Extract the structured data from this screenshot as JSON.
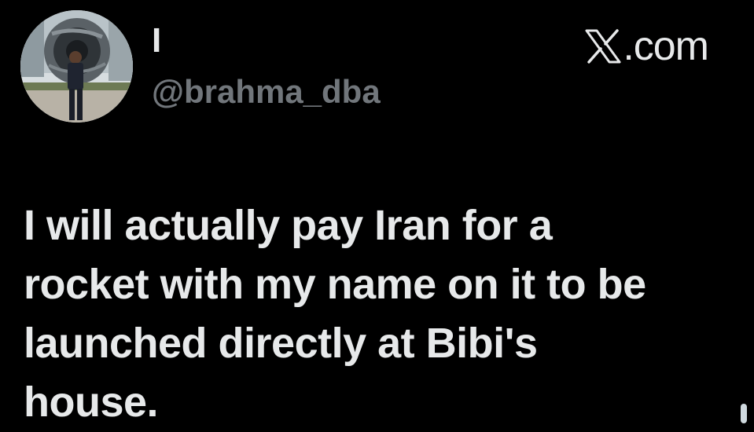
{
  "author": {
    "display_name": "I",
    "handle": "@brahma_dba",
    "avatar_icon": "profile-photo"
  },
  "watermark": {
    "logo_icon": "x-logo-icon",
    "text": ".com"
  },
  "tweet": {
    "text": "I will actually pay Iran for a\nrocket with my name on it to be\nlaunched directly at Bibi's\nhouse."
  },
  "colors": {
    "background": "#000000",
    "primary_text": "#e7e9ea",
    "secondary_text": "#71767b"
  }
}
